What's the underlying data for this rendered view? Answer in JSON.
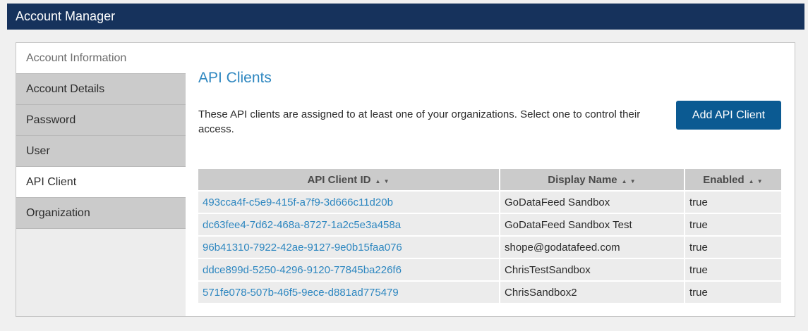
{
  "header": {
    "title": "Account Manager"
  },
  "sidebar": {
    "section_label": "Account Information",
    "items": [
      {
        "label": "Account Details"
      },
      {
        "label": "Password"
      },
      {
        "label": "User"
      },
      {
        "label": "API Client"
      },
      {
        "label": "Organization"
      }
    ],
    "active_index": 3
  },
  "main": {
    "title": "API Clients",
    "description": "These API clients are assigned to at least one of your organizations. Select one to control their access.",
    "add_button_label": "Add API Client",
    "table": {
      "columns": [
        "API Client ID",
        "Display Name",
        "Enabled"
      ],
      "sort_glyph": "▲ ▼",
      "rows": [
        {
          "id": "493cca4f-c5e9-415f-a7f9-3d666c11d20b",
          "name": "GoDataFeed Sandbox",
          "enabled": "true"
        },
        {
          "id": "dc63fee4-7d62-468a-8727-1a2c5e3a458a",
          "name": "GoDataFeed Sandbox Test",
          "enabled": "true"
        },
        {
          "id": "96b41310-7922-42ae-9127-9e0b15faa076",
          "name": "shope@godatafeed.com",
          "enabled": "true"
        },
        {
          "id": "ddce899d-5250-4296-9120-77845ba226f6",
          "name": "ChrisTestSandbox",
          "enabled": "true"
        },
        {
          "id": "571fe078-507b-46f5-9ece-d881ad775479",
          "name": "ChrisSandbox2",
          "enabled": "true"
        }
      ]
    }
  },
  "colors": {
    "header_bg": "#16325c",
    "accent": "#2e87c0",
    "button_bg": "#0b5a92"
  }
}
